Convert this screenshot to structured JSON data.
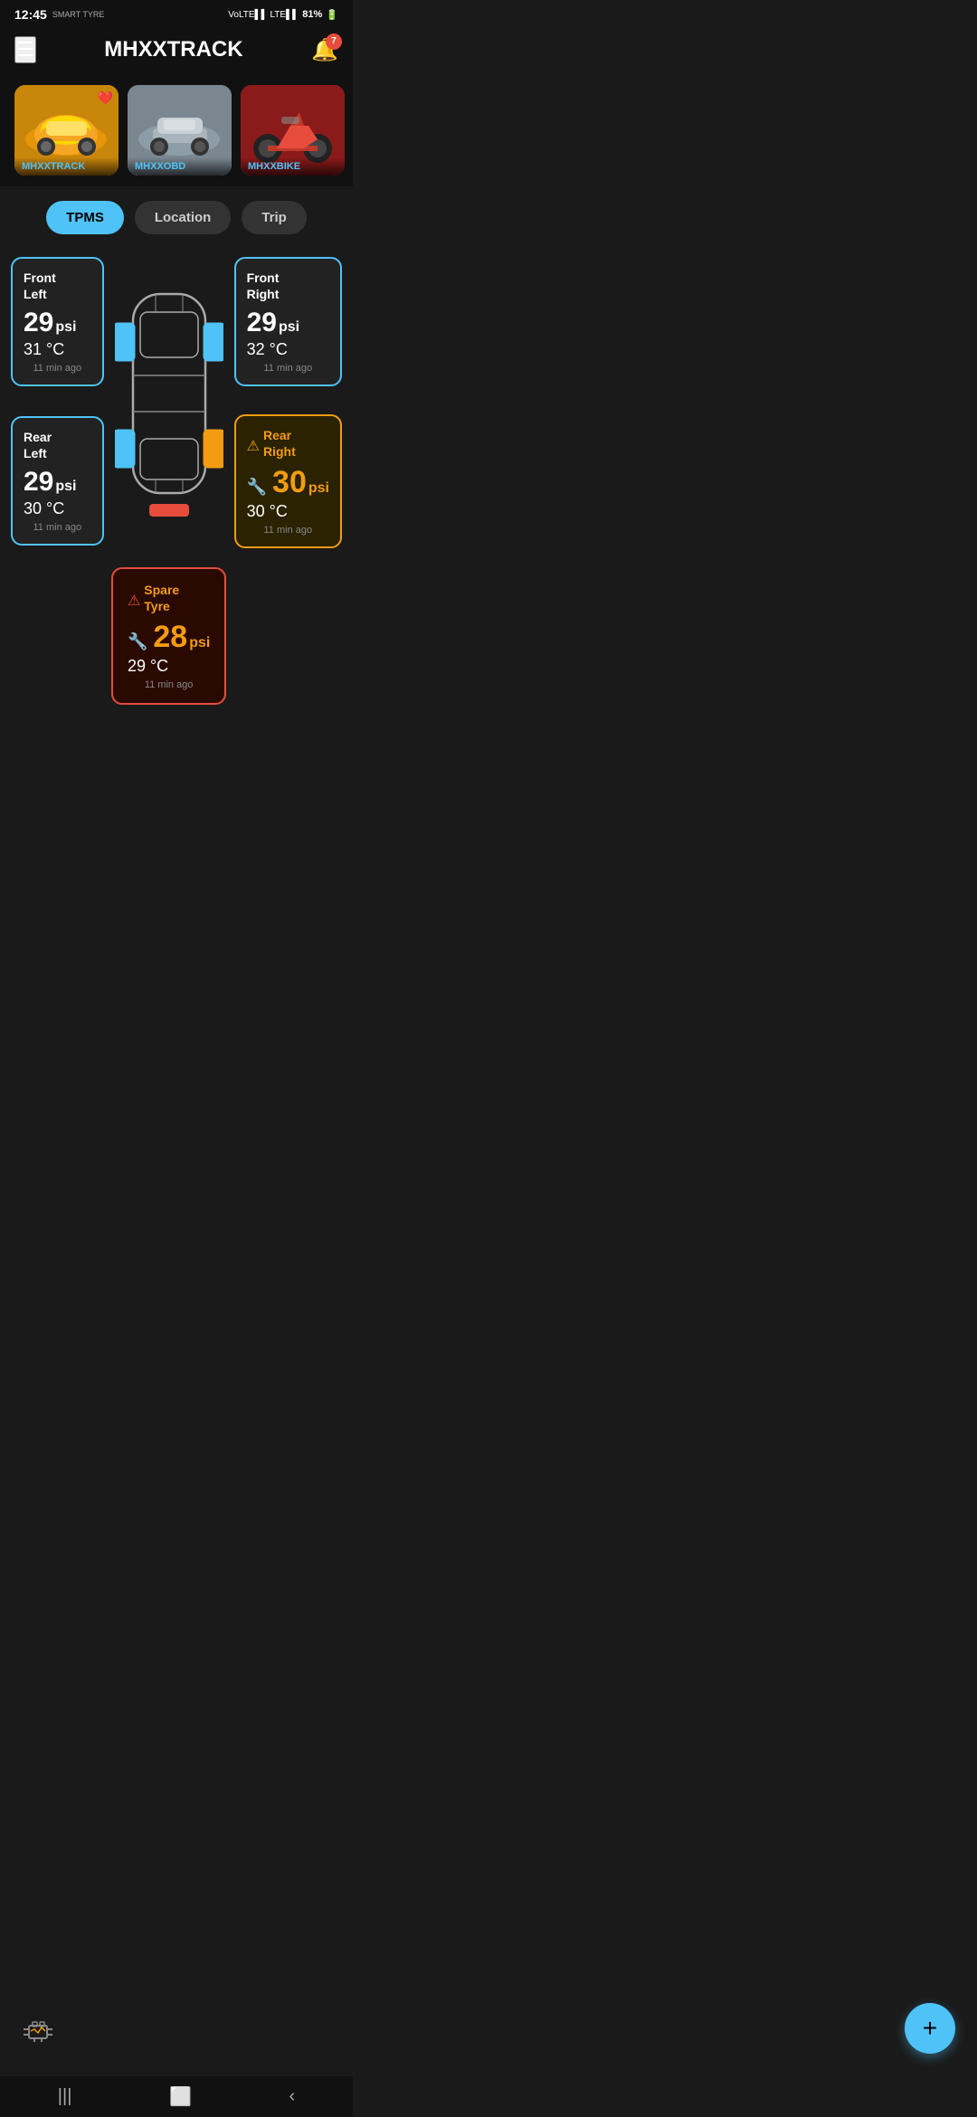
{
  "statusBar": {
    "time": "12:45",
    "smartTyre": "SMART TYRE",
    "signal": "VoLTE LTE",
    "battery": "81%"
  },
  "header": {
    "title": "MHXXTRACK",
    "notifCount": "7"
  },
  "vehicles": [
    {
      "name": "MHXXTRACK",
      "colorClass": "card-yellow",
      "favorite": true,
      "emoji": "🚗"
    },
    {
      "name": "MHXXOBD",
      "colorClass": "card-silver",
      "favorite": false,
      "emoji": "🚙"
    },
    {
      "name": "MHXXBIKE",
      "colorClass": "card-red",
      "favorite": false,
      "emoji": "🏍"
    }
  ],
  "tabs": [
    {
      "id": "tpms",
      "label": "TPMS",
      "active": true
    },
    {
      "id": "location",
      "label": "Location",
      "active": false
    },
    {
      "id": "trip",
      "label": "Trip",
      "active": false
    }
  ],
  "tires": {
    "frontLeft": {
      "name": "Front\nLeft",
      "psi": "29",
      "unit": "psi",
      "temp": "31 °C",
      "time": "11 min ago",
      "status": "normal"
    },
    "frontRight": {
      "name": "Front\nRight",
      "psi": "29",
      "unit": "psi",
      "temp": "32 °C",
      "time": "11 min ago",
      "status": "normal"
    },
    "rearLeft": {
      "name": "Rear\nLeft",
      "psi": "29",
      "unit": "psi",
      "temp": "30 °C",
      "time": "11 min ago",
      "status": "normal"
    },
    "rearRight": {
      "name": "Rear\nRight",
      "psi": "30",
      "unit": "psi",
      "temp": "30 °C",
      "time": "11 min ago",
      "status": "warning"
    },
    "spare": {
      "name": "Spare\nTyre",
      "psi": "28",
      "unit": "psi",
      "temp": "29 °C",
      "time": "11 min ago",
      "status": "danger"
    }
  },
  "fab": {
    "label": "+"
  },
  "bottomNav": {
    "items": [
      "|||",
      "⬜",
      "<"
    ]
  }
}
